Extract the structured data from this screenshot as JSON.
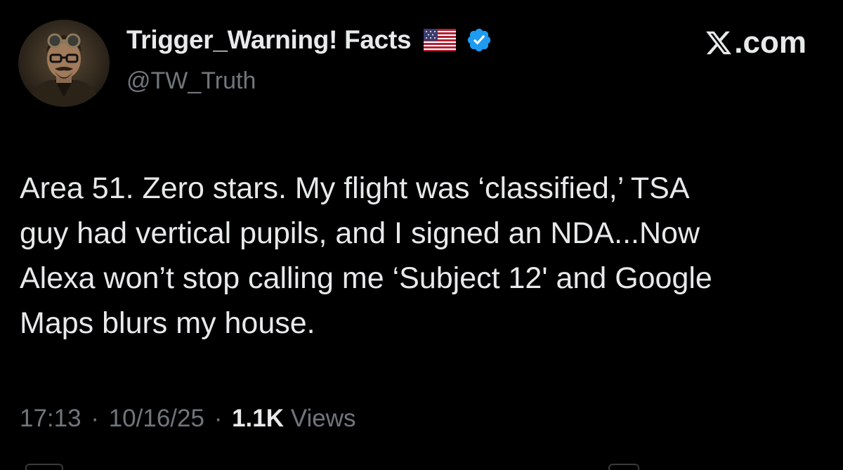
{
  "author": {
    "display_name": "Trigger_Warning! Facts",
    "handle": "@TW_Truth",
    "flag_icon": "us-flag-icon",
    "verified_icon": "verified-badge-icon",
    "verified_color": "#1d9bf0"
  },
  "brand": {
    "label": ".com",
    "icon": "x-logo-icon"
  },
  "tweet": {
    "text_lines": [
      "Area 51. Zero stars. My flight was ‘classified,’ TSA",
      "guy had vertical pupils, and I signed an NDA...Now",
      "Alexa won’t stop calling me ‘Subject 12' and Google",
      "Maps blurs my house."
    ]
  },
  "meta": {
    "time": "17:13",
    "separator": "·",
    "date": "10/16/25",
    "views_count": "1.1K",
    "views_label": "Views"
  },
  "colors": {
    "background": "#000000",
    "primary_text": "#e7e9ea",
    "secondary_text": "#71767b"
  }
}
